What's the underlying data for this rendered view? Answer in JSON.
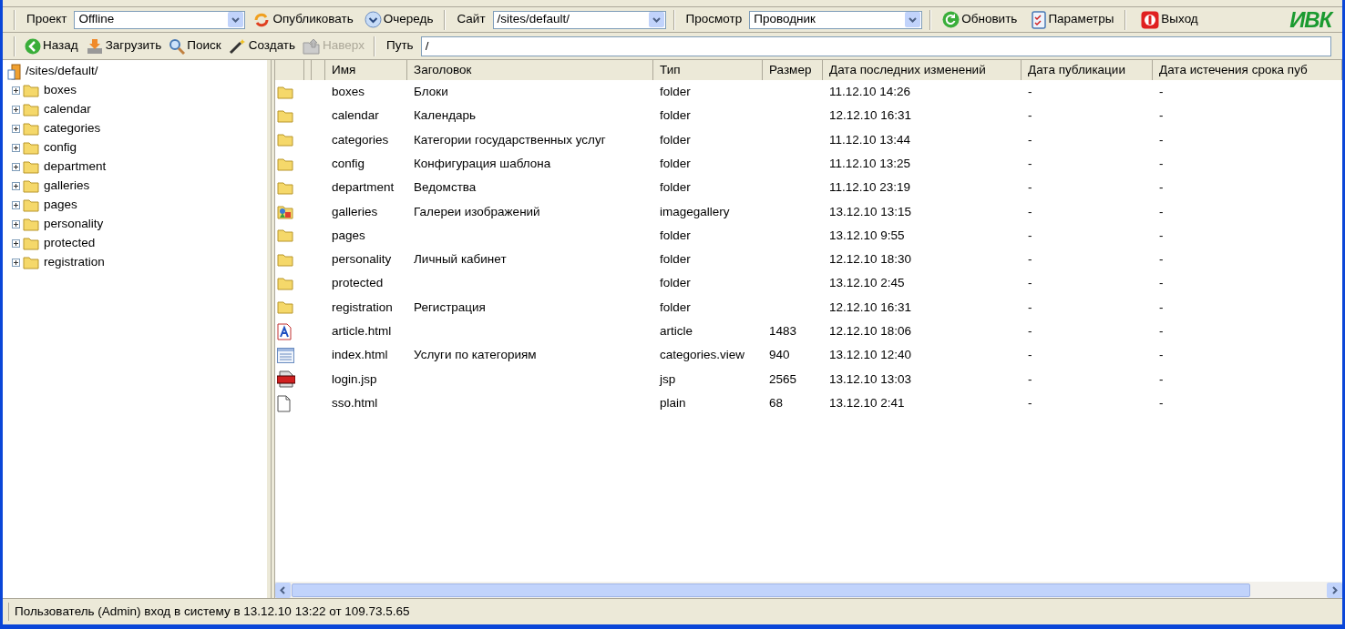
{
  "toolbar": {
    "project_label": "Проект",
    "project_value": "Offline",
    "publish": "Опубликовать",
    "queue": "Очередь",
    "site_label": "Сайт",
    "site_value": "/sites/default/",
    "view_label": "Просмотр",
    "view_value": "Проводник",
    "refresh": "Обновить",
    "settings": "Параметры",
    "exit": "Выход",
    "logo": "ИВК"
  },
  "nav": {
    "buttons": [
      {
        "kind": "back",
        "label": "Назад",
        "disabled": false
      },
      {
        "kind": "upload",
        "label": "Загрузить",
        "disabled": false
      },
      {
        "kind": "search",
        "label": "Поиск",
        "disabled": false
      },
      {
        "kind": "create",
        "label": "Создать",
        "disabled": false
      },
      {
        "kind": "up",
        "label": "Наверх",
        "disabled": true
      }
    ],
    "path_label": "Путь",
    "path_value": "/"
  },
  "tree": {
    "root": "/sites/default/",
    "children": [
      {
        "label": "boxes",
        "expanded": false
      },
      {
        "label": "calendar",
        "expanded": false
      },
      {
        "label": "categories",
        "expanded": false
      },
      {
        "label": "config",
        "expanded": false
      },
      {
        "label": "department",
        "expanded": false
      },
      {
        "label": "galleries",
        "expanded": false
      },
      {
        "label": "pages",
        "expanded": false
      },
      {
        "label": "personality",
        "expanded": false
      },
      {
        "label": "protected",
        "expanded": false
      },
      {
        "label": "registration",
        "expanded": false
      }
    ]
  },
  "table": {
    "columns": [
      "Имя",
      "Заголовок",
      "Тип",
      "Размер",
      "Дата последних изменений",
      "Дата публикации",
      "Дата истечения срока пуб"
    ],
    "rows": [
      {
        "kind": "folder",
        "name": "boxes",
        "title": "Блоки",
        "type": "folder",
        "size": "",
        "modified": "11.12.10 14:26",
        "published": "-",
        "expires": "-"
      },
      {
        "kind": "folder",
        "name": "calendar",
        "title": "Календарь",
        "type": "folder",
        "size": "",
        "modified": "12.12.10 16:31",
        "published": "-",
        "expires": "-"
      },
      {
        "kind": "folder",
        "name": "categories",
        "title": "Категории государственных услуг",
        "type": "folder",
        "size": "",
        "modified": "11.12.10 13:44",
        "published": "-",
        "expires": "-"
      },
      {
        "kind": "folder",
        "name": "config",
        "title": "Конфигурация шаблона",
        "type": "folder",
        "size": "",
        "modified": "11.12.10 13:25",
        "published": "-",
        "expires": "-"
      },
      {
        "kind": "folder",
        "name": "department",
        "title": "Ведомства",
        "type": "folder",
        "size": "",
        "modified": "11.12.10 23:19",
        "published": "-",
        "expires": "-"
      },
      {
        "kind": "gallery",
        "name": "galleries",
        "title": "Галереи изображений",
        "type": "imagegallery",
        "size": "",
        "modified": "13.12.10 13:15",
        "published": "-",
        "expires": "-"
      },
      {
        "kind": "folder",
        "name": "pages",
        "title": "",
        "type": "folder",
        "size": "",
        "modified": "13.12.10 9:55",
        "published": "-",
        "expires": "-"
      },
      {
        "kind": "folder",
        "name": "personality",
        "title": "Личный кабинет",
        "type": "folder",
        "size": "",
        "modified": "12.12.10 18:30",
        "published": "-",
        "expires": "-"
      },
      {
        "kind": "folder",
        "name": "protected",
        "title": "",
        "type": "folder",
        "size": "",
        "modified": "13.12.10 2:45",
        "published": "-",
        "expires": "-"
      },
      {
        "kind": "folder",
        "name": "registration",
        "title": "Регистрация",
        "type": "folder",
        "size": "",
        "modified": "12.12.10 16:31",
        "published": "-",
        "expires": "-"
      },
      {
        "kind": "article",
        "name": "article.html",
        "title": "",
        "type": "article",
        "size": "1483",
        "modified": "12.12.10 18:06",
        "published": "-",
        "expires": "-"
      },
      {
        "kind": "view",
        "name": "index.html",
        "title": "Услуги по категориям",
        "type": "categories.view",
        "size": "940",
        "modified": "13.12.10 12:40",
        "published": "-",
        "expires": "-"
      },
      {
        "kind": "jsp",
        "name": "login.jsp",
        "title": "",
        "type": "jsp",
        "size": "2565",
        "modified": "13.12.10 13:03",
        "published": "-",
        "expires": "-"
      },
      {
        "kind": "plain",
        "name": "sso.html",
        "title": "",
        "type": "plain",
        "size": "68",
        "modified": "13.12.10 2:41",
        "published": "-",
        "expires": "-"
      }
    ]
  },
  "status_bar": "Пользователь (Admin) вход в систему в 13.12.10 13:22 от 109.73.5.65"
}
